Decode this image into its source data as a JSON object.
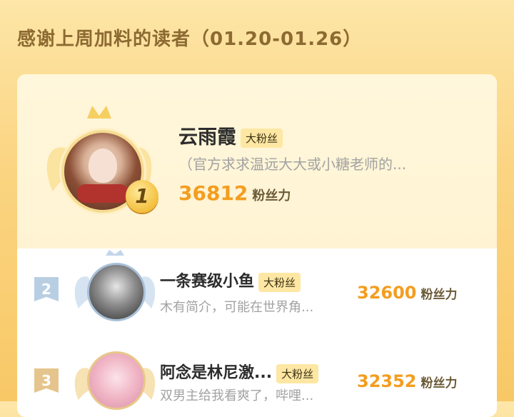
{
  "header": {
    "title": "感谢上周加料的读者（01.20-01.26）"
  },
  "readers": [
    {
      "rank": "1",
      "name": "云雨霞",
      "badge": "大粉丝",
      "desc": "（官方求求温远大大或小糖老师的...",
      "score": "36812",
      "unit": "粉丝力"
    },
    {
      "rank": "2",
      "name": "一条赛级小鱼",
      "badge": "大粉丝",
      "desc": "木有简介，可能在世界角...",
      "score": "32600",
      "unit": "粉丝力"
    },
    {
      "rank": "3",
      "name": "阿念是林尼激...",
      "badge": "大粉丝",
      "desc": "双男主给我看爽了，哔哩...",
      "score": "32352",
      "unit": "粉丝力"
    }
  ],
  "colors": {
    "accent": "#f39d1f",
    "badge_bg": "#fde7a3",
    "title": "#8c6a32"
  }
}
